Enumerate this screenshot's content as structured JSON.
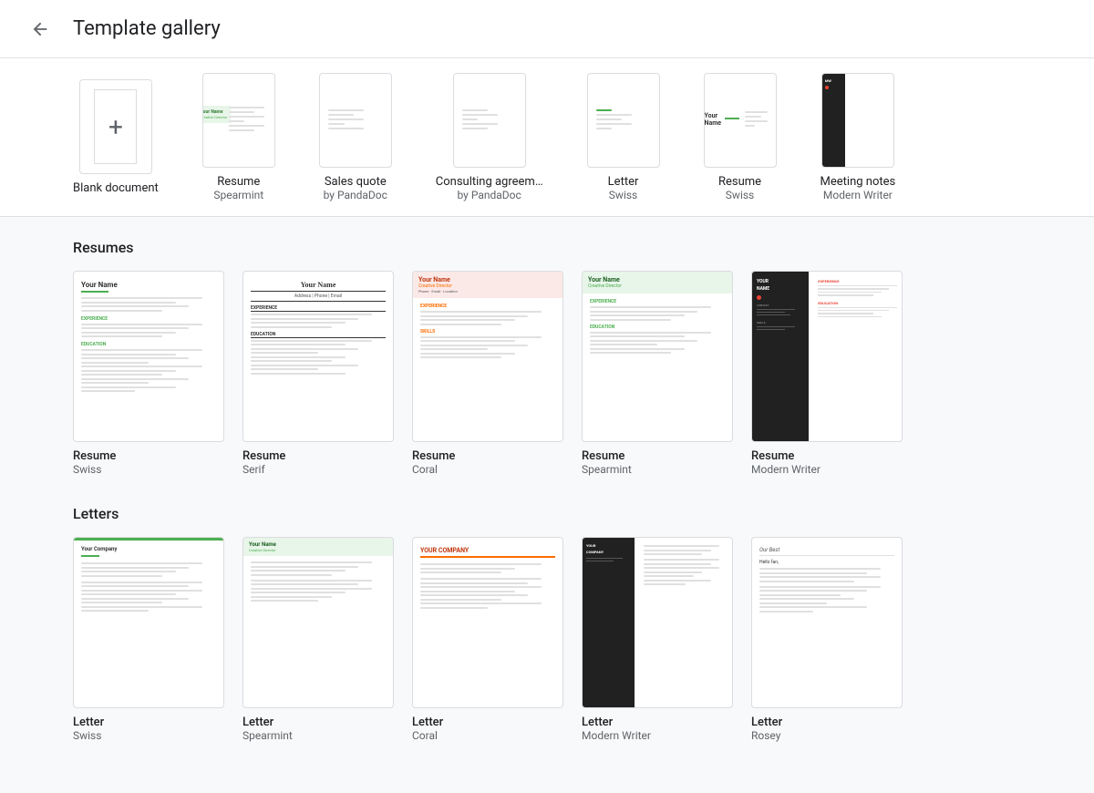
{
  "header": {
    "title": "Template gallery",
    "back_label": "Back"
  },
  "quick_templates": [
    {
      "id": "blank",
      "label": "Blank document",
      "sublabel": "",
      "style": "blank"
    },
    {
      "id": "resume-spearmint",
      "label": "Resume",
      "sublabel": "Spearmint",
      "style": "spearmint"
    },
    {
      "id": "sales-quote",
      "label": "Sales quote",
      "sublabel": "by PandaDoc",
      "style": "pandadoc"
    },
    {
      "id": "consulting",
      "label": "Consulting agreem…",
      "sublabel": "by PandaDoc",
      "style": "pandadoc2"
    },
    {
      "id": "letter-swiss",
      "label": "Letter",
      "sublabel": "Swiss",
      "style": "swiss-letter"
    },
    {
      "id": "resume-swiss-q",
      "label": "Resume",
      "sublabel": "Swiss",
      "style": "swiss"
    },
    {
      "id": "meeting-notes",
      "label": "Meeting notes",
      "sublabel": "Modern Writer",
      "style": "modern"
    }
  ],
  "sections": [
    {
      "id": "resumes",
      "title": "Resumes",
      "templates": [
        {
          "id": "r1",
          "label": "Resume",
          "sublabel": "Swiss",
          "style": "swiss"
        },
        {
          "id": "r2",
          "label": "Resume",
          "sublabel": "Serif",
          "style": "serif"
        },
        {
          "id": "r3",
          "label": "Resume",
          "sublabel": "Coral",
          "style": "coral"
        },
        {
          "id": "r4",
          "label": "Resume",
          "sublabel": "Spearmint",
          "style": "spearmint-lg"
        },
        {
          "id": "r5",
          "label": "Resume",
          "sublabel": "Modern Writer",
          "style": "modern-writer"
        }
      ]
    },
    {
      "id": "letters",
      "title": "Letters",
      "templates": [
        {
          "id": "l1",
          "label": "Letter",
          "sublabel": "Swiss",
          "style": "letter-swiss"
        },
        {
          "id": "l2",
          "label": "Letter",
          "sublabel": "Spearmint",
          "style": "letter-spearmint"
        },
        {
          "id": "l3",
          "label": "Letter",
          "sublabel": "Coral",
          "style": "letter-coral"
        },
        {
          "id": "l4",
          "label": "Letter",
          "sublabel": "Modern Writer",
          "style": "letter-modern"
        },
        {
          "id": "l5",
          "label": "Letter",
          "sublabel": "Rosey",
          "style": "letter-rosey"
        }
      ]
    }
  ]
}
